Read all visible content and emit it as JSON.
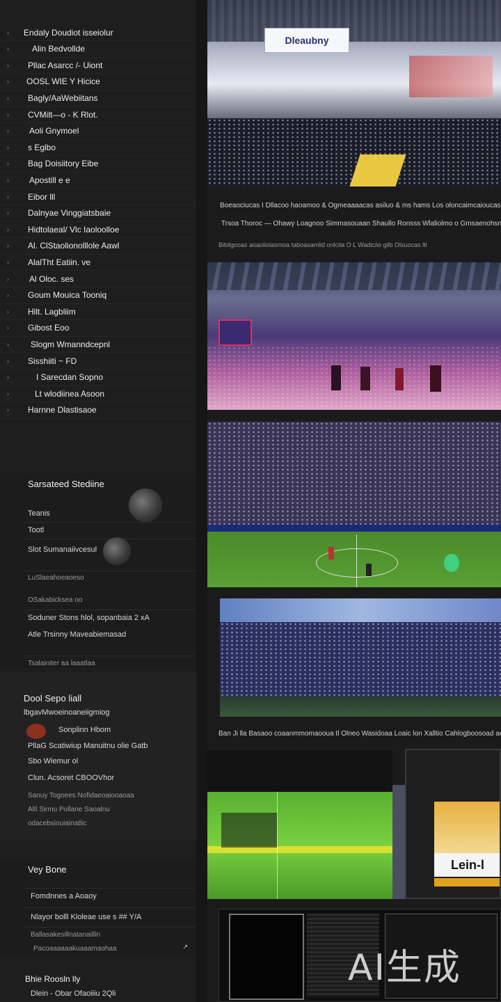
{
  "sidebar": {
    "items": [
      {
        "label": "Endaly Doudiot isseiolur"
      },
      {
        "label": "Alin Bedvollde"
      },
      {
        "label": "Pllac Asarcc /- Uiont"
      },
      {
        "label": "OOSL WIE Y Hicice"
      },
      {
        "label": "Bagly/AaWebiitans"
      },
      {
        "label": "CVMilt—o - K Rlot."
      },
      {
        "label": "Aoli Gnymoel"
      },
      {
        "label": "s Eglbo"
      },
      {
        "label": "Bag Doisiitory Eibe"
      },
      {
        "label": "Apostill e e"
      },
      {
        "label": "Eibor lll"
      },
      {
        "label": "Dalnyae Vinggiatsbaie"
      },
      {
        "label": "Hidtolaeal/ Vlc Iaoloolloe"
      },
      {
        "label": "Al. ClStaolionolllole Aawl"
      },
      {
        "label": "AlalTht Eatiin. ve"
      },
      {
        "label": "Al Oloc. ses"
      },
      {
        "label": "Goum Mouica Tooniq"
      },
      {
        "label": "Hllt. Lagbliim"
      },
      {
        "label": "Gibost Eoo"
      },
      {
        "label": "Slogm Wmanndcepnl"
      },
      {
        "label": "Sisshiiti ~ FD"
      },
      {
        "label": "I Sarecdan Sopno"
      },
      {
        "label": "Lt wlodiinea Asoon"
      },
      {
        "label": "Harnne Dlastisaoe"
      }
    ],
    "section_one": {
      "title": "Sarsateed Stediine",
      "rows": [
        "Teanis",
        "Tootl",
        "Slot Sumanaiivcesul",
        "LuSlaeahoeaoeso",
        "OSakabicksea oo"
      ],
      "highlight_lines": [
        "Soduner Stons hlol, sopanbaia 2 xA",
        "Atle Trsinny Maveabiemasad"
      ],
      "footer": "Tsalainiter aa laaatlaa"
    },
    "section_two": {
      "title": "Dool Sepo liall",
      "rows": [
        "lbgavMwoeinoaneiigmiog",
        "Sonplinn Hbom",
        "PllaG Scatiwiup Manuitnu olie Gatb",
        "Sbo Wiemur ol",
        "Clun. Acsoret CBOOVhor",
        "Sanuy Togoees Nofidaeoaiooaoaa",
        "Alll Sirmu Pollane Saoalnu",
        "odacebsinuiainatlic"
      ]
    },
    "section_three": {
      "title": "Vey Bone",
      "rows": [
        "Fomdnnes a Aoaoy",
        "Nlayor bolll Kloleae use s ## Y/A",
        "Ballasakesillnatanaillin",
        "Pacoaaaaaakuaaamaohaa"
      ]
    },
    "footer": {
      "title": "Bhie Roosln lly",
      "subtitle": "Dlein - Obar Ofaoiiiu 2Qli"
    }
  },
  "main": {
    "banner_sign": "Dleaubny",
    "caption_1_line_1": "Boeaociucas I Dllacoo haoamoo & Ogmeaaaacas asiluo & ms hams Los oloncaimcaioucas: roulc",
    "caption_1_line_2": "Trsoa Thoroc — Ohawy Loagnoo  Simmasouaan Shaullo Ronsss Wlaliolmo o Gmsaenohsnoo Limdiguooasuonas",
    "caption_1_line_3": "Bibilgooas aoaolioiasmoa taboasamlid onlcila O L Wadiciio gilb Olsuocas ltl",
    "caption_2": "Ban Ji lla Basaoo coaanmmomaooua tl Olneo  Wasidoaa Loaic lon Xalltio Cahlogboosoad ao ba aana",
    "score_text": "Lein-l",
    "watermark": "AI生成"
  }
}
